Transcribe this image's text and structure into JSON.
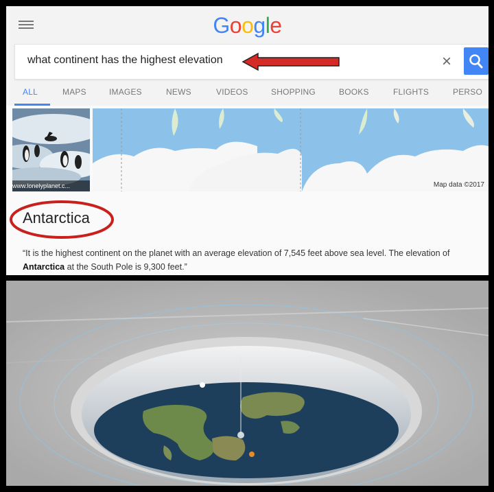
{
  "logo": {
    "letters": [
      "G",
      "o",
      "o",
      "g",
      "l",
      "e"
    ],
    "colors": [
      "#4285f4",
      "#ea4335",
      "#fbbc05",
      "#4285f4",
      "#34a853",
      "#ea4335"
    ]
  },
  "search": {
    "query": "what continent has the highest elevation",
    "annotation_color": "#d52b27"
  },
  "tabs": [
    "ALL",
    "MAPS",
    "IMAGES",
    "NEWS",
    "VIDEOS",
    "SHOPPING",
    "BOOKS",
    "FLIGHTS",
    "PERSO"
  ],
  "active_tab": "ALL",
  "photo_caption": "www.lonelyplanet.c...",
  "map_credit": "Map data ©2017",
  "answer": {
    "title": "Antarctica",
    "snippet_part1": "“It is the highest continent on the planet with an average elevation of 7,545 feet above sea level. The elevation of ",
    "snippet_bold": "Antarctica",
    "snippet_part2": " at the South Pole is 9,300 feet.”"
  },
  "colors": {
    "accent": "#4285f4",
    "annotation_red": "#c8211d"
  }
}
